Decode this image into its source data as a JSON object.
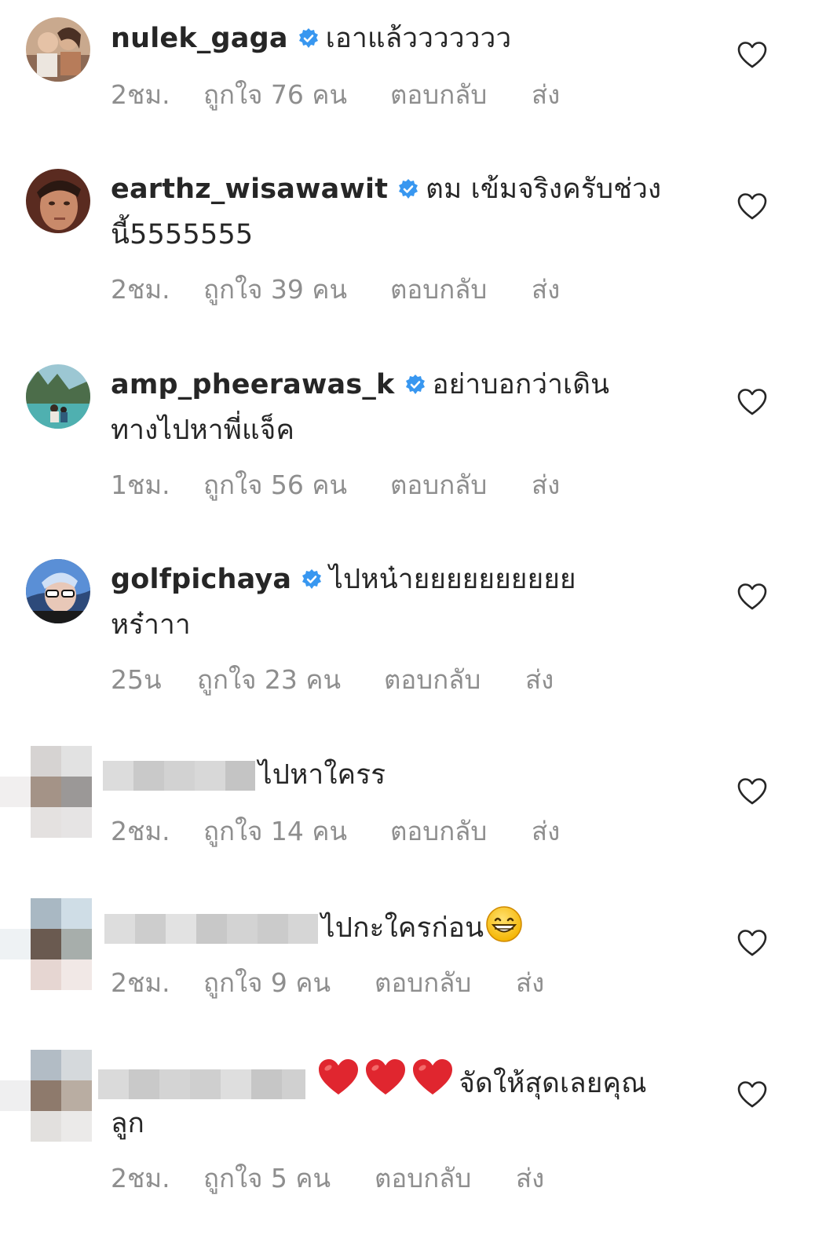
{
  "comments": [
    {
      "username": "nulek_gaga",
      "verified": true,
      "text": "เอาแล้ววววววว",
      "time": "2ชม.",
      "likes": "ถูกใจ 76 คน",
      "reply": "ตอบกลับ",
      "send": "ส่ง",
      "avatar": "avatar-photo"
    },
    {
      "username": "earthz_wisawawit",
      "verified": true,
      "text_line1": "ตม เข้มจริงครับช่วง",
      "text_line2": "นี้5555555",
      "time": "2ชม.",
      "likes": "ถูกใจ 39 คน",
      "reply": "ตอบกลับ",
      "send": "ส่ง",
      "avatar": "avatar-photo"
    },
    {
      "username": "amp_pheerawas_k",
      "verified": true,
      "text_line1": "อย่าบอกว่าเดิน",
      "text_line2": "ทางไปหาพี่แจ็ค",
      "time": "1ชม.",
      "likes": "ถูกใจ 56 คน",
      "reply": "ตอบกลับ",
      "send": "ส่ง",
      "avatar": "avatar-photo"
    },
    {
      "username": "golfpichaya",
      "verified": true,
      "text_line1": "ไปหน๋ายยยยยยยยยย",
      "text_line2": "หร๋าาา",
      "time": "25น",
      "likes": "ถูกใจ 23 คน",
      "reply": "ตอบกลับ",
      "send": "ส่ง",
      "avatar": "avatar-photo"
    },
    {
      "username_blurred": true,
      "text": "ไปหาใครร",
      "time": "2ชม.",
      "likes": "ถูกใจ 14 คน",
      "reply": "ตอบกลับ",
      "send": "ส่ง",
      "avatar": "pixelated-avatar"
    },
    {
      "username_blurred": true,
      "text": "ไปกะใครก่อน",
      "emoji": "grinning-face",
      "time": "2ชม.",
      "likes": "ถูกใจ 9 คน",
      "reply": "ตอบกลับ",
      "send": "ส่ง",
      "avatar": "pixelated-avatar"
    },
    {
      "username_blurred": true,
      "emoji": "red-heart x3",
      "text_line1": "จัดให้สุดเลยคุณ",
      "text_line2": "ลูก",
      "time": "2ชม.",
      "likes": "ถูกใจ 5 คน",
      "reply": "ตอบกลับ",
      "send": "ส่ง",
      "avatar": "pixelated-avatar"
    }
  ],
  "icons": {
    "like": "heart-outline-icon",
    "verified": "verified-badge-icon"
  },
  "colors": {
    "text": "#262626",
    "meta": "#8e8e8e",
    "verified": "#3897f0",
    "emoji_heart": "#e0262f"
  }
}
